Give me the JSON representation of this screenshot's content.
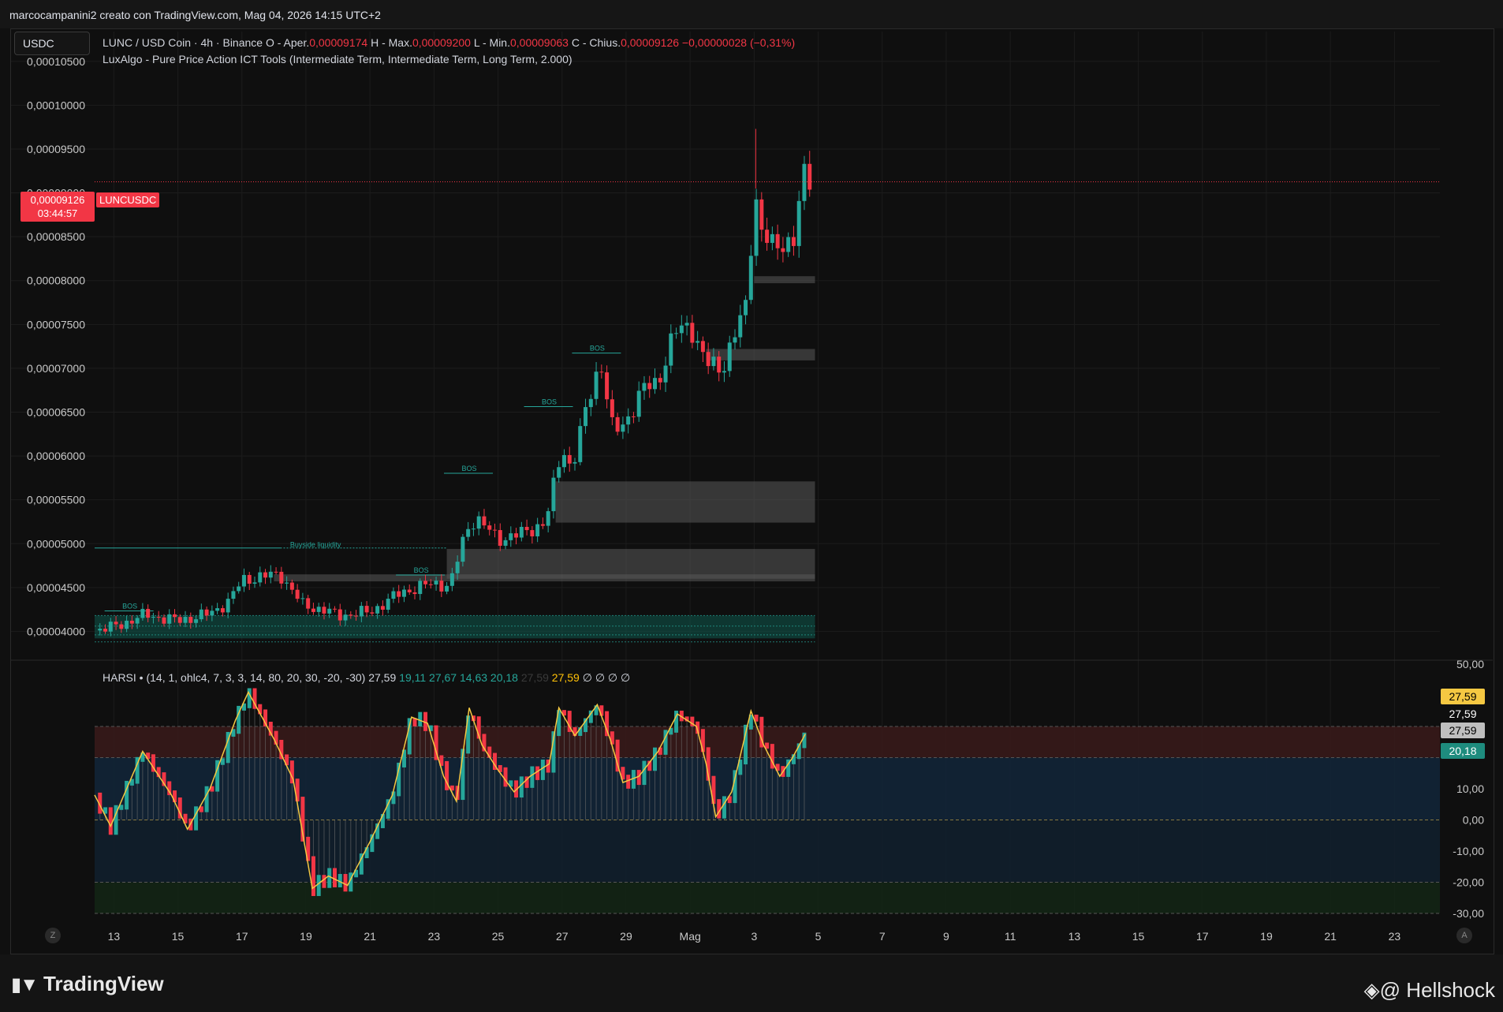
{
  "header": {
    "credit": "marcocampanini2 creato con TradingView.com, Mag 04, 2026 14:15 UTC+2"
  },
  "symbol_box": {
    "label": "USDC"
  },
  "legend": {
    "main": {
      "prefix": "LUNC / USD Coin · 4h · Binance  O - Aper.",
      "open": "0,00009174",
      "h_label": "  H - Max.",
      "high": "0,00009200",
      "l_label": "  L - Min.",
      "low": "0,00009063",
      "c_label": "  C - Chius.",
      "close": "0,00009126",
      "change": "  −0,00000028 (−0,31%)"
    },
    "indicator": "LuxAlgo - Pure Price Action ICT Tools (Intermediate Term, Intermediate Term, Long Term, 2.000)",
    "harsi": {
      "name": "HARSI",
      "params": " • (14, 1, ohlc4, 7, 3, 3, 14, 80, 20, 30, -20, -30)",
      "v1": "27,59",
      "v2": "19,11",
      "v3": "27,67",
      "v4": "14,63",
      "v5": "20,18",
      "v6": "27,59",
      "v7": "27,59",
      "empties": "∅  ∅  ∅  ∅"
    }
  },
  "price_tag": {
    "price": "0,00009126",
    "countdown": "03:44:57",
    "symbol": "LUNCUSDC"
  },
  "osc_tags": [
    {
      "value": "27,59",
      "bg": "#f5c842",
      "fg": "#000000"
    },
    {
      "value": "27,59",
      "bg": "#0f0f0f",
      "fg": "#ffffff"
    },
    {
      "value": "27,59",
      "bg": "#bfbfbf",
      "fg": "#000000"
    },
    {
      "value": "20,18",
      "bg": "#1e8c7e",
      "fg": "#ffffff"
    }
  ],
  "footer": {
    "logo": "TradingView",
    "signature": "@ Hellshock"
  },
  "buttons": {
    "left": "Z",
    "right": "A"
  },
  "colors": {
    "up": "#26a69a",
    "down": "#f23645",
    "oscillator_line": "#f5c842"
  },
  "chart_data": [
    {
      "type": "candlestick",
      "title": "LUNC / USD Coin · 4h · Binance",
      "y_tick_labels": [
        "0,00010500",
        "0,00010000",
        "0,00009500",
        "0,00009000",
        "0,00008500",
        "0,00008000",
        "0,00007500",
        "0,00007000",
        "0,00006500",
        "0,00006000",
        "0,00005500",
        "0,00005000",
        "0,00004500",
        "0,00004000"
      ],
      "y_ticks": [
        0.000105,
        0.0001,
        9.5e-05,
        9e-05,
        8.5e-05,
        8e-05,
        7.5e-05,
        7e-05,
        6.5e-05,
        6e-05,
        5.5e-05,
        5e-05,
        4.5e-05,
        4e-05
      ],
      "ylim": [
        3.68e-05,
        0.0001075
      ],
      "x_tick_labels": [
        "13",
        "15",
        "17",
        "19",
        "21",
        "23",
        "25",
        "27",
        "29",
        "Mag",
        "3",
        "5",
        "7",
        "9",
        "11",
        "13",
        "15",
        "17",
        "19",
        "21",
        "23"
      ],
      "x_tick_days": [
        13,
        15,
        17,
        19,
        21,
        23,
        25,
        27,
        29,
        31,
        33,
        35,
        37,
        39,
        41,
        43,
        45,
        47,
        49,
        51,
        53
      ],
      "x_unit": "day of April 2026 (31 = May 1)",
      "xlim": [
        12.35,
        55.2
      ],
      "last_price": 9.126e-05,
      "price_anchors": [
        {
          "day": 12.4,
          "price": 4.01e-05
        },
        {
          "day": 13.0,
          "price": 4.05e-05
        },
        {
          "day": 14.0,
          "price": 4.19e-05
        },
        {
          "day": 15.0,
          "price": 4.12e-05
        },
        {
          "day": 16.0,
          "price": 4.2e-05
        },
        {
          "day": 16.6,
          "price": 4.35e-05
        },
        {
          "day": 17.0,
          "price": 4.58e-05
        },
        {
          "day": 17.5,
          "price": 4.62e-05
        },
        {
          "day": 18.2,
          "price": 4.65e-05
        },
        {
          "day": 18.9,
          "price": 4.3e-05
        },
        {
          "day": 19.5,
          "price": 4.25e-05
        },
        {
          "day": 20.0,
          "price": 4.18e-05
        },
        {
          "day": 21.0,
          "price": 4.22e-05
        },
        {
          "day": 22.0,
          "price": 4.45e-05
        },
        {
          "day": 23.0,
          "price": 4.55e-05
        },
        {
          "day": 23.5,
          "price": 4.52e-05
        },
        {
          "day": 24.0,
          "price": 5.15e-05
        },
        {
          "day": 24.3,
          "price": 5.3e-05
        },
        {
          "day": 25.0,
          "price": 5.05e-05
        },
        {
          "day": 25.8,
          "price": 5.12e-05
        },
        {
          "day": 26.5,
          "price": 5.25e-05
        },
        {
          "day": 27.0,
          "price": 6.1e-05
        },
        {
          "day": 27.3,
          "price": 5.85e-05
        },
        {
          "day": 27.8,
          "price": 6.6e-05
        },
        {
          "day": 28.2,
          "price": 7.1e-05
        },
        {
          "day": 28.6,
          "price": 6.25e-05
        },
        {
          "day": 29.0,
          "price": 6.4e-05
        },
        {
          "day": 29.5,
          "price": 6.75e-05
        },
        {
          "day": 30.0,
          "price": 6.85e-05
        },
        {
          "day": 30.5,
          "price": 7.4e-05
        },
        {
          "day": 31.0,
          "price": 7.5e-05
        },
        {
          "day": 31.5,
          "price": 7.05e-05
        },
        {
          "day": 32.0,
          "price": 7e-05
        },
        {
          "day": 32.3,
          "price": 7.3e-05
        },
        {
          "day": 32.8,
          "price": 7.75e-05
        },
        {
          "day": 33.0,
          "price": 9.1e-05
        },
        {
          "day": 33.2,
          "price": 8.6e-05
        },
        {
          "day": 33.6,
          "price": 8.35e-05
        },
        {
          "day": 34.0,
          "price": 8.45e-05
        },
        {
          "day": 34.3,
          "price": 8.5e-05
        },
        {
          "day": 34.5,
          "price": 9.2e-05
        },
        {
          "day": 34.75,
          "price": 9.13e-05
        }
      ],
      "annotations": [
        {
          "text": "BOS",
          "day": 13.5,
          "price": 4.26e-05
        },
        {
          "text": "BOS",
          "day": 22.6,
          "price": 4.67e-05
        },
        {
          "text": "BOS",
          "day": 24.1,
          "price": 5.83e-05
        },
        {
          "text": "BOS",
          "day": 26.6,
          "price": 6.59e-05
        },
        {
          "text": "BOS",
          "day": 28.1,
          "price": 7.2e-05
        },
        {
          "text": "Buyside liquidity",
          "day": 19.3,
          "price": 4.96e-05
        }
      ],
      "zones": [
        {
          "day_from": 18.0,
          "day_to": 34.9,
          "price_from": 4.57e-05,
          "price_to": 4.65e-05
        },
        {
          "day_from": 23.4,
          "day_to": 34.9,
          "price_from": 4.6e-05,
          "price_to": 4.94e-05
        },
        {
          "day_from": 26.8,
          "day_to": 34.9,
          "price_from": 5.24e-05,
          "price_to": 5.71e-05
        },
        {
          "day_from": 31.5,
          "day_to": 34.9,
          "price_from": 7.09e-05,
          "price_to": 7.22e-05
        },
        {
          "day_from": 33.0,
          "day_to": 34.9,
          "price_from": 7.97e-05,
          "price_to": 8.05e-05
        }
      ],
      "lower_zone": {
        "day_from": 12.4,
        "day_to": 34.9,
        "price_from": 3.92e-05,
        "price_to": 4.18e-05
      }
    },
    {
      "type": "oscillator",
      "title": "HARSI",
      "y_tick_labels": [
        "50,00",
        "10,00",
        "0,00",
        "-10,00",
        "-20,00",
        "-30,00"
      ],
      "y_ticks": [
        50,
        10,
        0,
        -10,
        -20,
        -30
      ],
      "ylim": [
        -30.5,
        51
      ],
      "levels": [
        30,
        20,
        0,
        -20,
        -30
      ],
      "last_value": 20.18,
      "line_anchors": [
        {
          "day": 12.4,
          "v": 8
        },
        {
          "day": 12.9,
          "v": -2
        },
        {
          "day": 13.9,
          "v": 22
        },
        {
          "day": 14.8,
          "v": 8
        },
        {
          "day": 15.3,
          "v": -3
        },
        {
          "day": 16.0,
          "v": 10
        },
        {
          "day": 16.8,
          "v": 32
        },
        {
          "day": 17.2,
          "v": 41
        },
        {
          "day": 18.0,
          "v": 26
        },
        {
          "day": 18.6,
          "v": 13
        },
        {
          "day": 19.2,
          "v": -22
        },
        {
          "day": 19.7,
          "v": -18
        },
        {
          "day": 20.3,
          "v": -21
        },
        {
          "day": 21.0,
          "v": -7
        },
        {
          "day": 21.7,
          "v": 8
        },
        {
          "day": 22.3,
          "v": 33
        },
        {
          "day": 22.8,
          "v": 31
        },
        {
          "day": 23.3,
          "v": 14
        },
        {
          "day": 23.7,
          "v": 6
        },
        {
          "day": 24.1,
          "v": 36
        },
        {
          "day": 24.5,
          "v": 24
        },
        {
          "day": 25.0,
          "v": 16
        },
        {
          "day": 25.5,
          "v": 9
        },
        {
          "day": 26.0,
          "v": 14
        },
        {
          "day": 26.6,
          "v": 18
        },
        {
          "day": 26.9,
          "v": 36
        },
        {
          "day": 27.4,
          "v": 27
        },
        {
          "day": 28.1,
          "v": 37
        },
        {
          "day": 28.5,
          "v": 26
        },
        {
          "day": 28.9,
          "v": 12
        },
        {
          "day": 29.4,
          "v": 14
        },
        {
          "day": 30.0,
          "v": 22
        },
        {
          "day": 30.6,
          "v": 34
        },
        {
          "day": 31.2,
          "v": 30
        },
        {
          "day": 31.5,
          "v": 18
        },
        {
          "day": 31.8,
          "v": 1
        },
        {
          "day": 32.3,
          "v": 9
        },
        {
          "day": 32.9,
          "v": 35
        },
        {
          "day": 33.3,
          "v": 24
        },
        {
          "day": 33.8,
          "v": 14
        },
        {
          "day": 34.2,
          "v": 20
        },
        {
          "day": 34.6,
          "v": 27.6
        }
      ]
    }
  ]
}
